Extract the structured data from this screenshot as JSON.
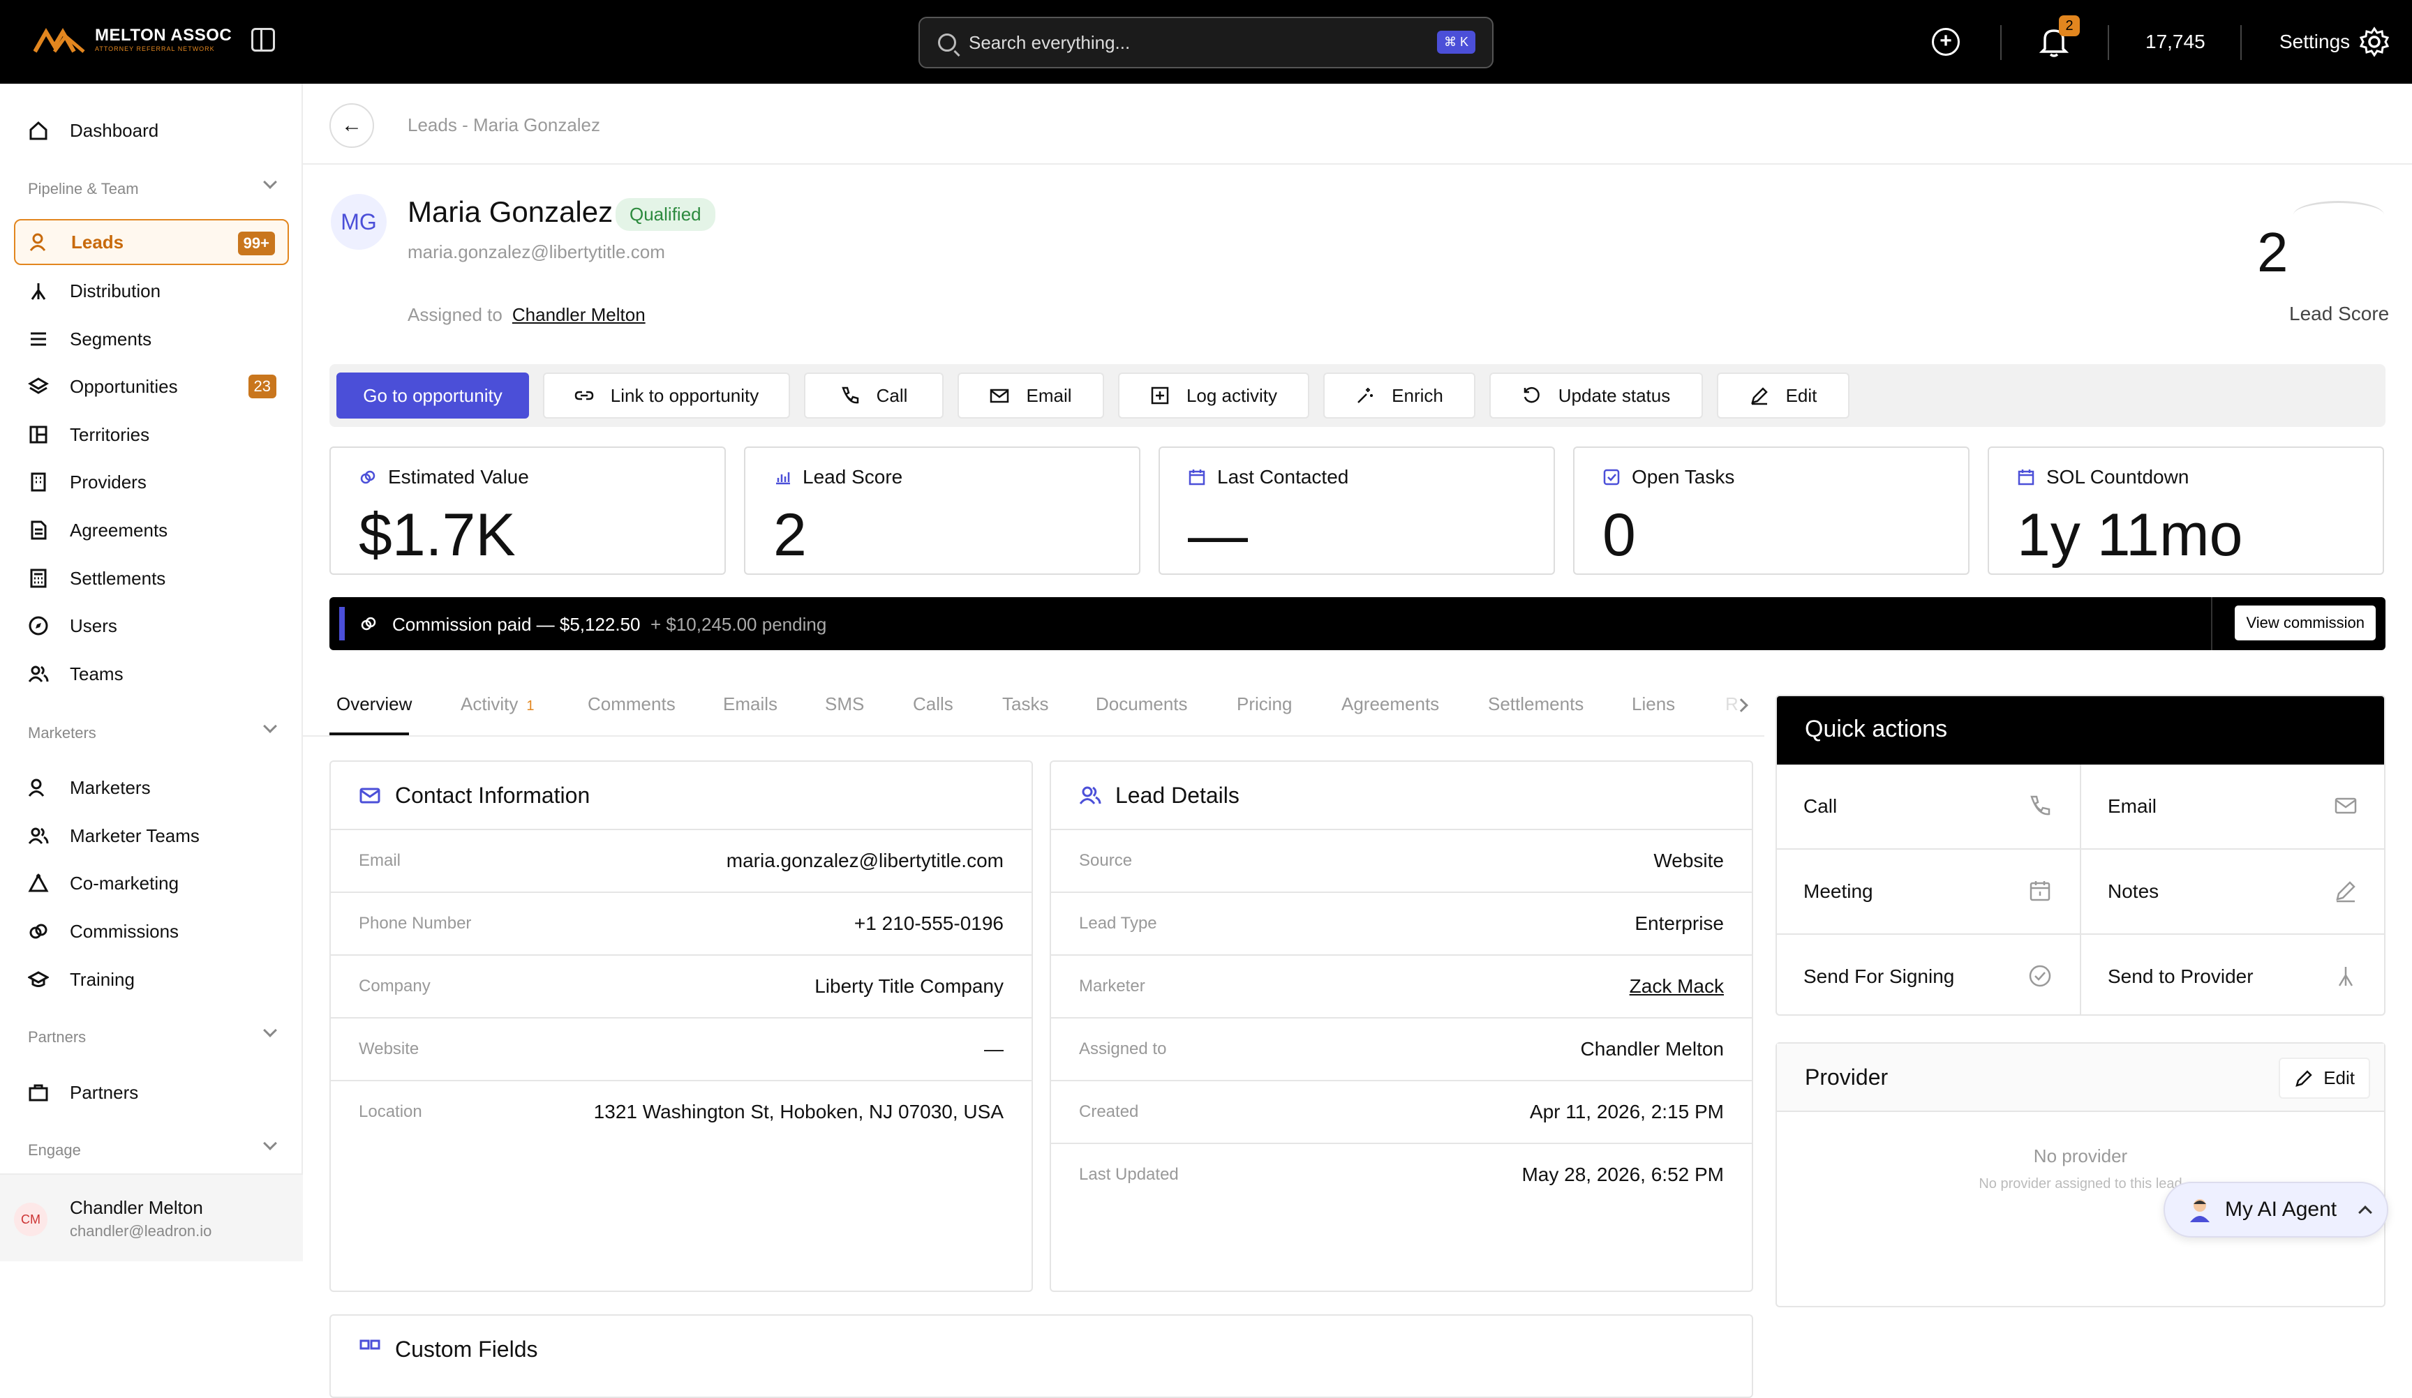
{
  "brand": {
    "name": "MELTON ASSOC",
    "tagline": "ATTORNEY REFERRAL NETWORK",
    "accent": "#e2861f",
    "primary": "#4b4fd8"
  },
  "topbar": {
    "search_placeholder": "Search everything...",
    "search_shortcut": "⌘ K",
    "notification_count": "2",
    "credits": "17,745",
    "settings_label": "Settings"
  },
  "sidebar": {
    "dashboard": "Dashboard",
    "section_pipeline": "Pipeline & Team",
    "pipeline_items": [
      {
        "label": "Leads",
        "badge": "99+",
        "icon": "user-icon"
      },
      {
        "label": "Distribution",
        "icon": "fork-icon"
      },
      {
        "label": "Segments",
        "icon": "list-icon"
      },
      {
        "label": "Opportunities",
        "badge": "23",
        "icon": "layers-icon"
      },
      {
        "label": "Territories",
        "icon": "grid-icon"
      },
      {
        "label": "Providers",
        "icon": "building-icon"
      },
      {
        "label": "Agreements",
        "icon": "document-icon"
      },
      {
        "label": "Settlements",
        "icon": "calculator-icon"
      },
      {
        "label": "Users",
        "icon": "compass-icon"
      },
      {
        "label": "Teams",
        "icon": "users-icon"
      }
    ],
    "section_marketers": "Marketers",
    "marketer_items": [
      {
        "label": "Marketers",
        "icon": "user-icon"
      },
      {
        "label": "Marketer Teams",
        "icon": "users-icon"
      },
      {
        "label": "Co-marketing",
        "icon": "triangle-icon"
      },
      {
        "label": "Commissions",
        "icon": "link-icon"
      },
      {
        "label": "Training",
        "icon": "graduation-icon"
      }
    ],
    "section_partners": "Partners",
    "partner_items": [
      {
        "label": "Partners",
        "icon": "briefcase-icon"
      }
    ],
    "section_engage": "Engage",
    "user": {
      "initials": "CM",
      "name": "Chandler Melton",
      "email": "chandler@leadron.io"
    }
  },
  "breadcrumb": "Leads - Maria Gonzalez",
  "lead": {
    "initials": "MG",
    "name": "Maria Gonzalez",
    "status": "Qualified",
    "email": "maria.gonzalez@libertytitle.com",
    "assigned_label": "Assigned to",
    "assigned_to": "Chandler Melton",
    "score": "2",
    "score_label": "Lead Score"
  },
  "actions": {
    "go": "Go to opportunity",
    "link": "Link to opportunity",
    "call": "Call",
    "email": "Email",
    "log": "Log activity",
    "enrich": "Enrich",
    "update": "Update status",
    "edit": "Edit"
  },
  "stats": [
    {
      "label": "Estimated Value",
      "value": "$1.7K"
    },
    {
      "label": "Lead Score",
      "value": "2"
    },
    {
      "label": "Last Contacted",
      "value": "—"
    },
    {
      "label": "Open Tasks",
      "value": "0"
    },
    {
      "label": "SOL Countdown",
      "value": "1y 11mo"
    }
  ],
  "commission": {
    "paid": "Commission paid — $5,122.50",
    "pending": "+ $10,245.00 pending",
    "button": "View commission"
  },
  "tabs": [
    {
      "label": "Overview"
    },
    {
      "label": "Activity",
      "count": "1"
    },
    {
      "label": "Comments"
    },
    {
      "label": "Emails"
    },
    {
      "label": "SMS"
    },
    {
      "label": "Calls"
    },
    {
      "label": "Tasks"
    },
    {
      "label": "Documents"
    },
    {
      "label": "Pricing"
    },
    {
      "label": "Agreements"
    },
    {
      "label": "Settlements"
    },
    {
      "label": "Liens"
    },
    {
      "label": "R"
    }
  ],
  "contact": {
    "title": "Contact Information",
    "rows": [
      {
        "k": "Email",
        "v": "maria.gonzalez@libertytitle.com"
      },
      {
        "k": "Phone Number",
        "v": "+1 210-555-0196"
      },
      {
        "k": "Company",
        "v": "Liberty Title Company"
      },
      {
        "k": "Website",
        "v": "—"
      },
      {
        "k": "Location",
        "v": "1321 Washington St, Hoboken, NJ 07030, USA"
      }
    ]
  },
  "details": {
    "title": "Lead Details",
    "rows": [
      {
        "k": "Source",
        "v": "Website"
      },
      {
        "k": "Lead Type",
        "v": "Enterprise"
      },
      {
        "k": "Marketer",
        "v": "Zack Mack"
      },
      {
        "k": "Assigned to",
        "v": "Chandler Melton"
      },
      {
        "k": "Created",
        "v": "Apr 11, 2026, 2:15 PM"
      },
      {
        "k": "Last Updated",
        "v": "May 28, 2026, 6:52 PM"
      }
    ]
  },
  "custom_fields_title": "Custom Fields",
  "quick_actions": {
    "title": "Quick actions",
    "items": [
      "Call",
      "Email",
      "Meeting",
      "Notes",
      "Send For Signing",
      "Send to Provider"
    ]
  },
  "provider": {
    "title": "Provider",
    "edit": "Edit",
    "empty": "No provider",
    "empty_sub": "No provider assigned to this lead"
  },
  "agent": {
    "label": "My AI Agent"
  }
}
